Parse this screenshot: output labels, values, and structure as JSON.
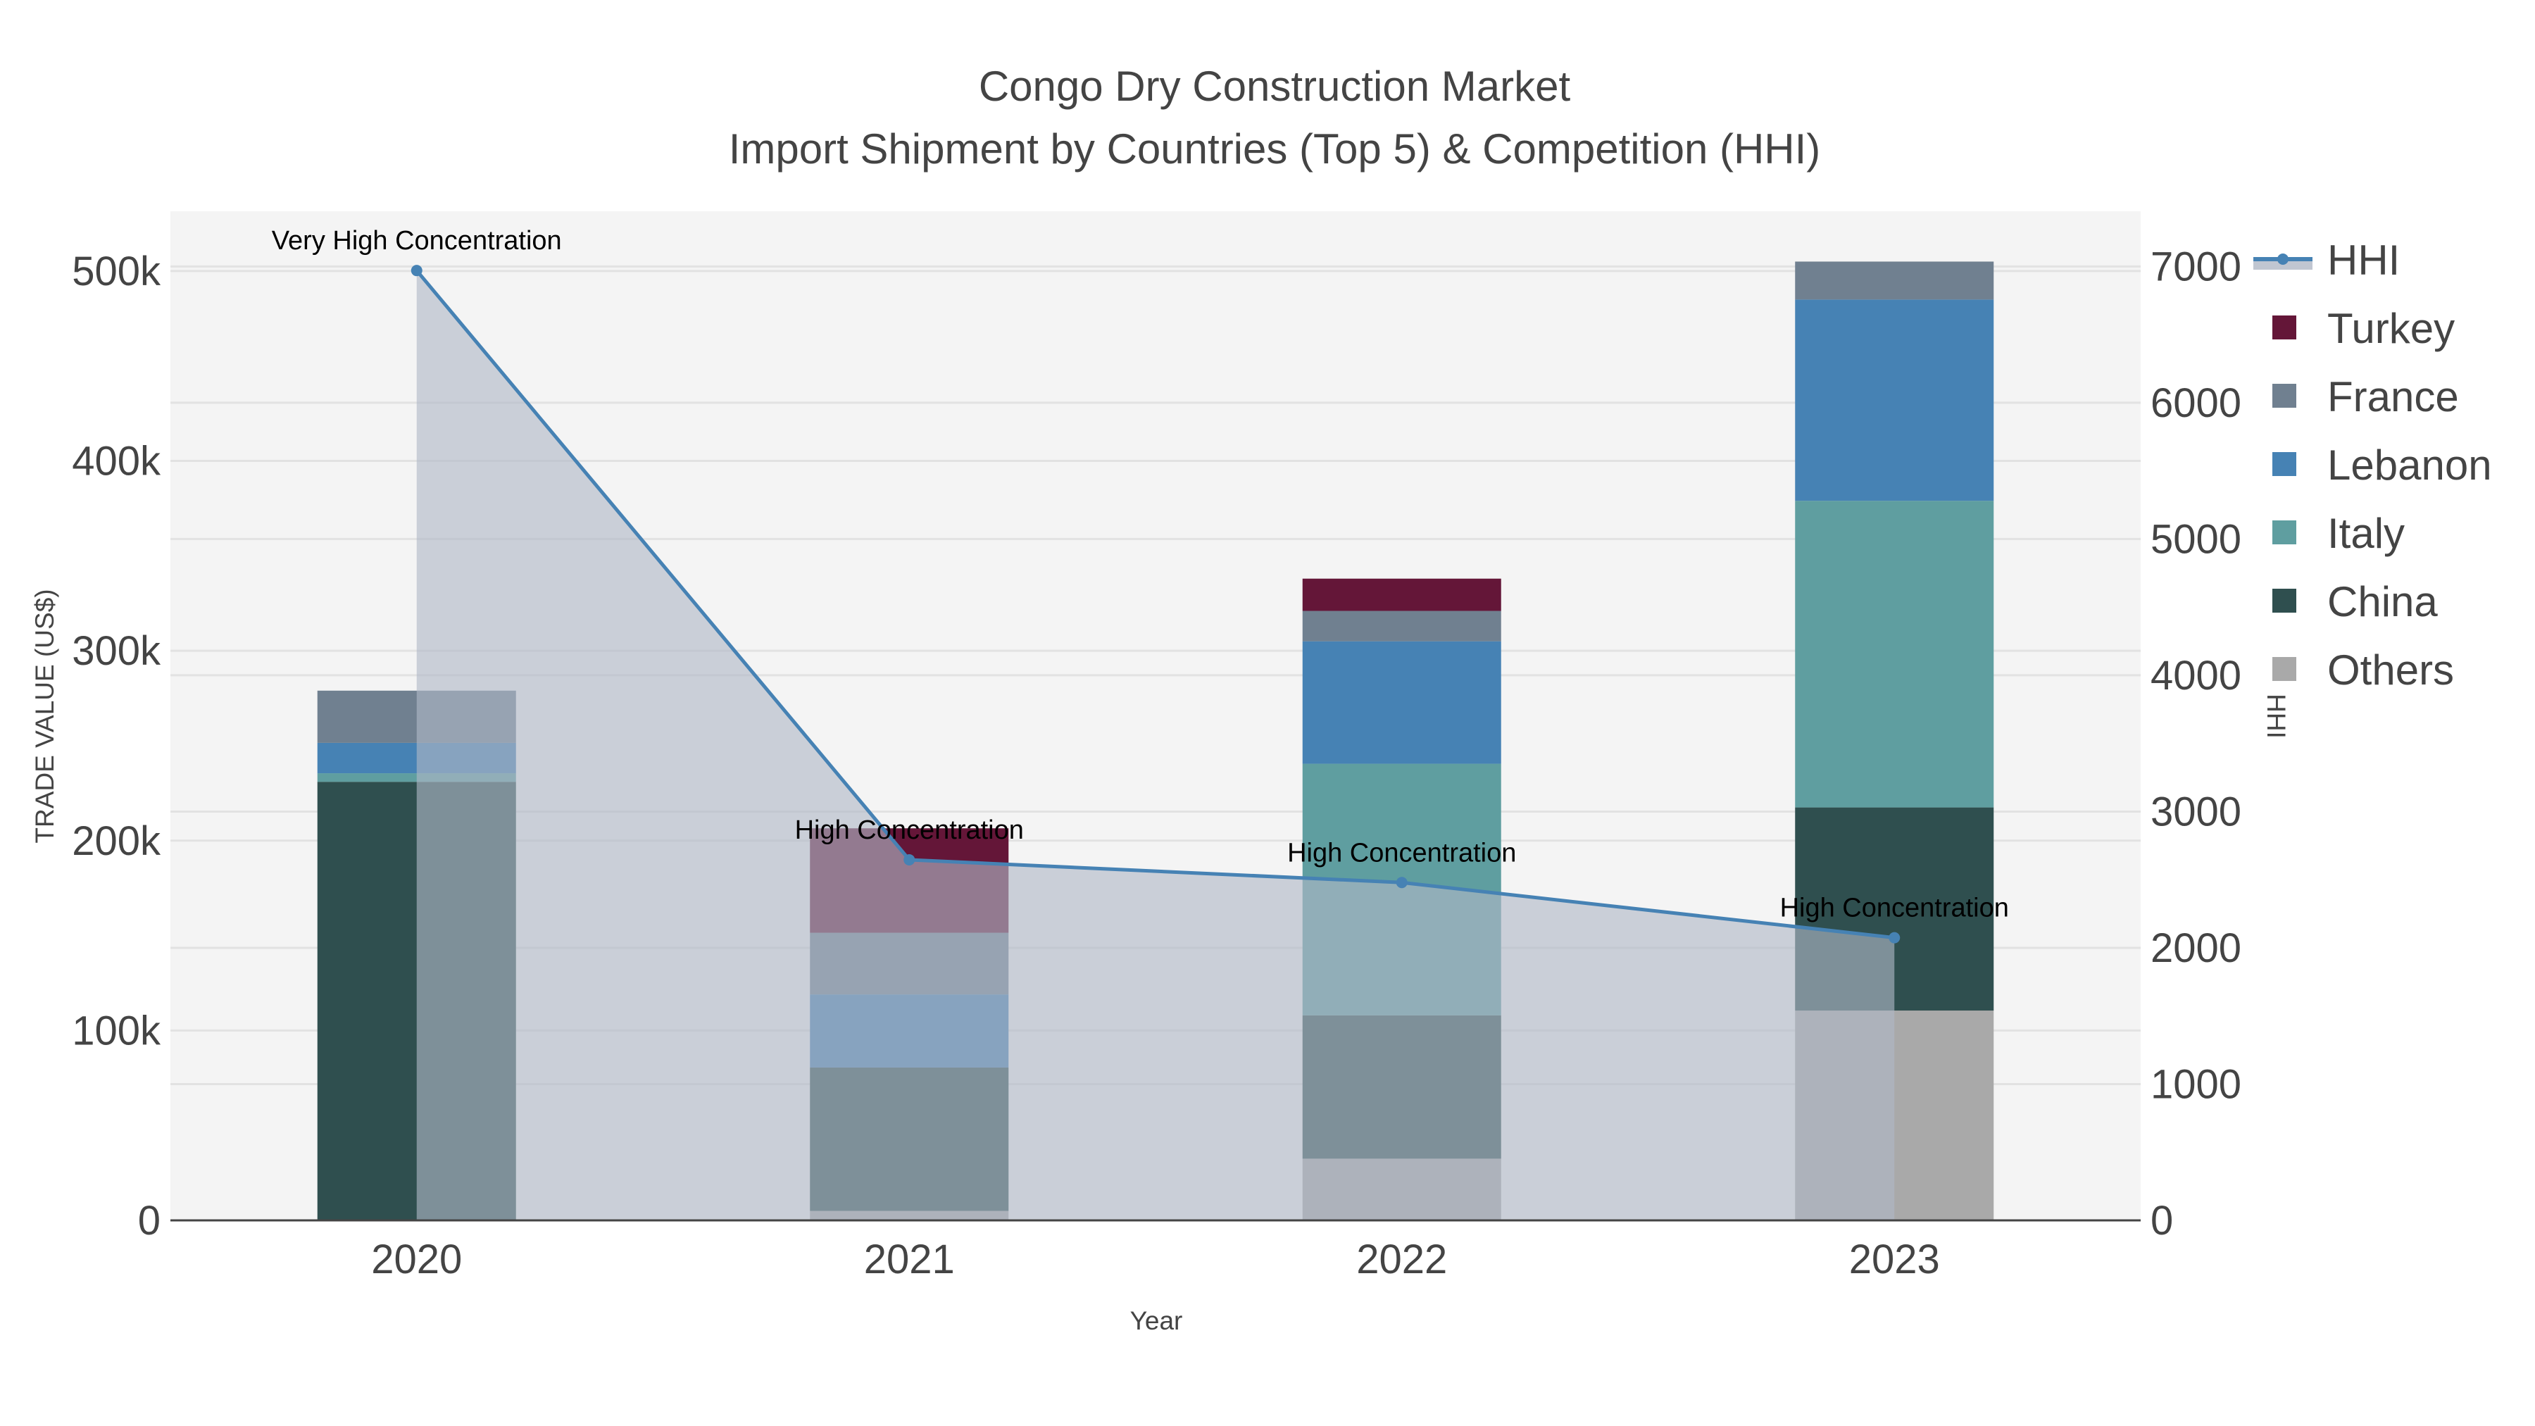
{
  "chart_data": {
    "type": "bar",
    "title": "Congo Dry Construction Market",
    "subtitle": "Import Shipment by Countries (Top 5) & Competition (HHI)",
    "xlabel": "Year",
    "ylabel": "TRADE VALUE (US$)",
    "y2label": "HHI",
    "categories": [
      "2020",
      "2021",
      "2022",
      "2023"
    ],
    "ylim": [
      0,
      531500
    ],
    "y2lim": [
      0,
      7405
    ],
    "yticks": [
      0,
      100000,
      200000,
      300000,
      400000,
      500000
    ],
    "ytick_labels": [
      "0",
      "100k",
      "200k",
      "300k",
      "400k",
      "500k"
    ],
    "y2ticks": [
      0,
      1000,
      2000,
      3000,
      4000,
      5000,
      6000,
      7000
    ],
    "y2tick_labels": [
      "0",
      "1000",
      "2000",
      "3000",
      "4000",
      "5000",
      "6000",
      "7000"
    ],
    "stacked": true,
    "series": [
      {
        "name": "Others",
        "color": "#A9A9A9",
        "values": [
          0,
          5000,
          32500,
          110500
        ]
      },
      {
        "name": "China",
        "color": "#2F4F4F",
        "values": [
          231000,
          75500,
          75500,
          107000
        ]
      },
      {
        "name": "Italy",
        "color": "#5F9EA0",
        "values": [
          4500,
          0,
          132500,
          161500
        ]
      },
      {
        "name": "Lebanon",
        "color": "#4682B4",
        "values": [
          16000,
          38500,
          64500,
          106000
        ]
      },
      {
        "name": "France",
        "color": "#708090",
        "values": [
          27500,
          32500,
          16000,
          20000
        ]
      },
      {
        "name": "Turkey",
        "color": "#641638",
        "values": [
          0,
          55000,
          17000,
          0
        ]
      }
    ],
    "line": {
      "name": "HHI",
      "color": "#4682B4",
      "axis": "right",
      "values": [
        6970,
        2646,
        2479,
        2074
      ],
      "labels": [
        "Very High Concentration",
        "High Concentration",
        "High Concentration",
        "High Concentration"
      ]
    },
    "legend": [
      "HHI",
      "Turkey",
      "France",
      "Lebanon",
      "Italy",
      "China",
      "Others"
    ],
    "legend_position": "right",
    "grid": true
  }
}
